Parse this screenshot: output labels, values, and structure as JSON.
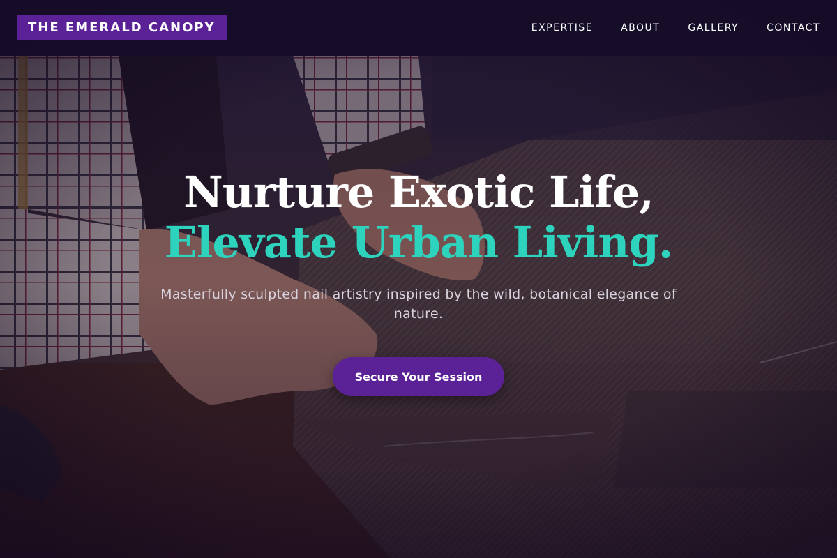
{
  "header": {
    "logo": "THE EMERALD CANOPY",
    "nav": [
      "EXPERTISE",
      "ABOUT",
      "GALLERY",
      "CONTACT"
    ]
  },
  "hero": {
    "headline_line1": "Nurture Exotic Life,",
    "headline_line2": "Elevate Urban Living.",
    "subtitle": "Masterfully sculpted nail artistry inspired by the wild, botanical elegance of nature.",
    "cta_label": "Secure Your Session"
  },
  "colors": {
    "brand_purple": "#5b2196",
    "accent_teal": "#2ed3bd",
    "header_bg": "#160c28"
  }
}
